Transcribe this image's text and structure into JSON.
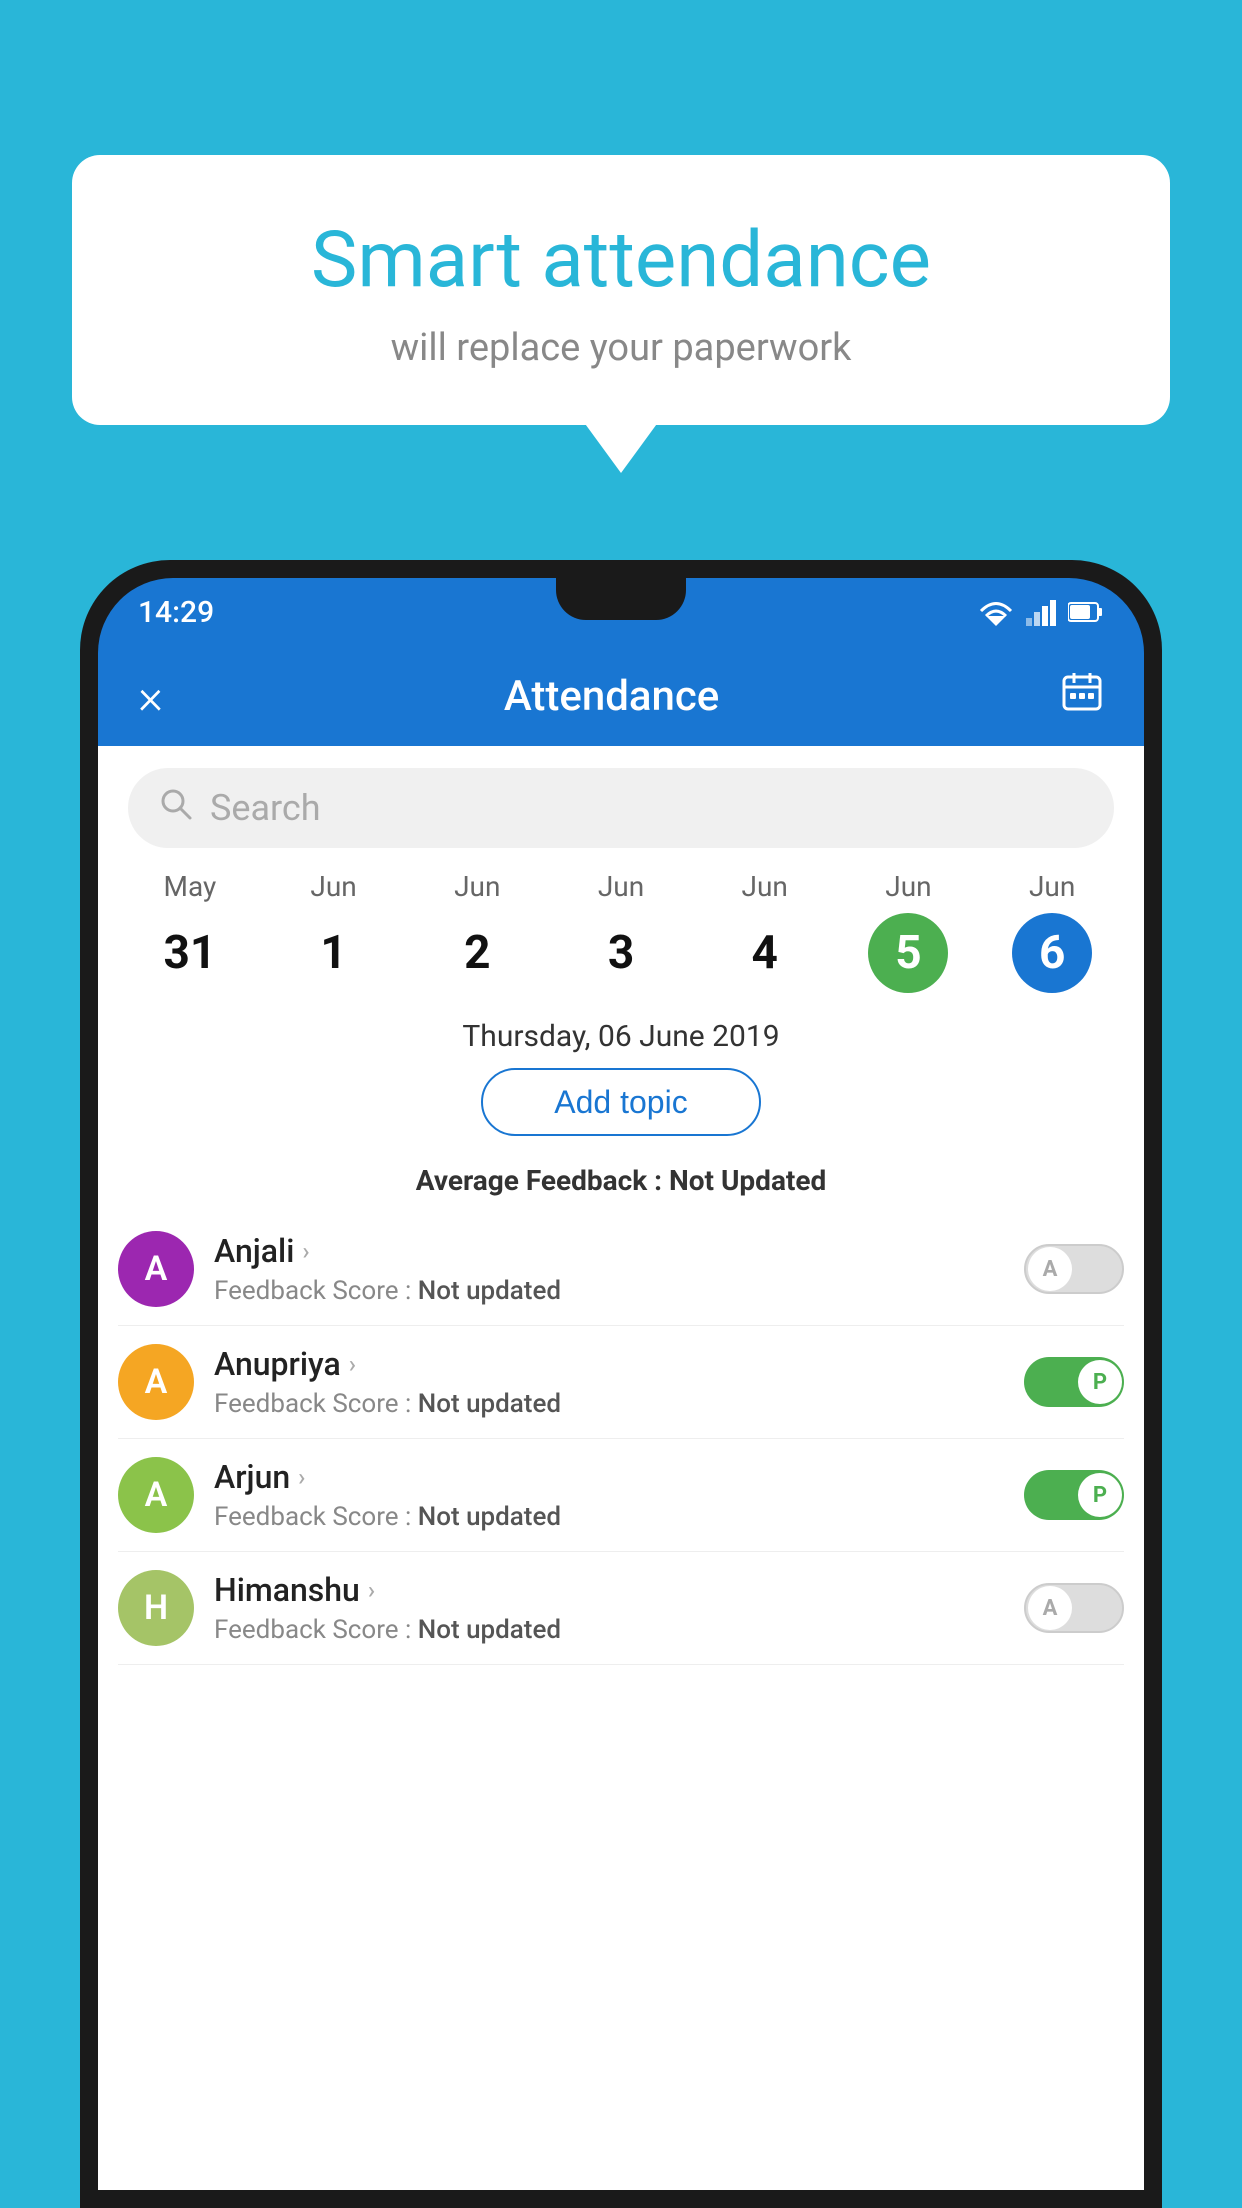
{
  "background_color": "#29b6d8",
  "bubble": {
    "title": "Smart attendance",
    "subtitle": "will replace your paperwork"
  },
  "status_bar": {
    "time": "14:29"
  },
  "app_bar": {
    "title": "Attendance",
    "close_label": "×",
    "calendar_label": "📅"
  },
  "search": {
    "placeholder": "Search"
  },
  "calendar": {
    "days": [
      {
        "month": "May",
        "num": "31",
        "state": "normal"
      },
      {
        "month": "Jun",
        "num": "1",
        "state": "normal"
      },
      {
        "month": "Jun",
        "num": "2",
        "state": "normal"
      },
      {
        "month": "Jun",
        "num": "3",
        "state": "normal"
      },
      {
        "month": "Jun",
        "num": "4",
        "state": "normal"
      },
      {
        "month": "Jun",
        "num": "5",
        "state": "today"
      },
      {
        "month": "Jun",
        "num": "6",
        "state": "selected"
      }
    ]
  },
  "selected_date": "Thursday, 06 June 2019",
  "add_topic_label": "Add topic",
  "avg_feedback_label": "Average Feedback :",
  "avg_feedback_value": "Not Updated",
  "students": [
    {
      "name": "Anjali",
      "avatar_letter": "A",
      "avatar_color": "#9c27b0",
      "feedback_label": "Feedback Score :",
      "feedback_value": "Not updated",
      "toggle": "off",
      "toggle_letter": "A"
    },
    {
      "name": "Anupriya",
      "avatar_letter": "A",
      "avatar_color": "#f5a623",
      "feedback_label": "Feedback Score :",
      "feedback_value": "Not updated",
      "toggle": "on",
      "toggle_letter": "P"
    },
    {
      "name": "Arjun",
      "avatar_letter": "A",
      "avatar_color": "#8bc34a",
      "feedback_label": "Feedback Score :",
      "feedback_value": "Not updated",
      "toggle": "on",
      "toggle_letter": "P"
    },
    {
      "name": "Himanshu",
      "avatar_letter": "H",
      "avatar_color": "#a5c467",
      "feedback_label": "Feedback Score :",
      "feedback_value": "Not updated",
      "toggle": "off",
      "toggle_letter": "A"
    }
  ]
}
